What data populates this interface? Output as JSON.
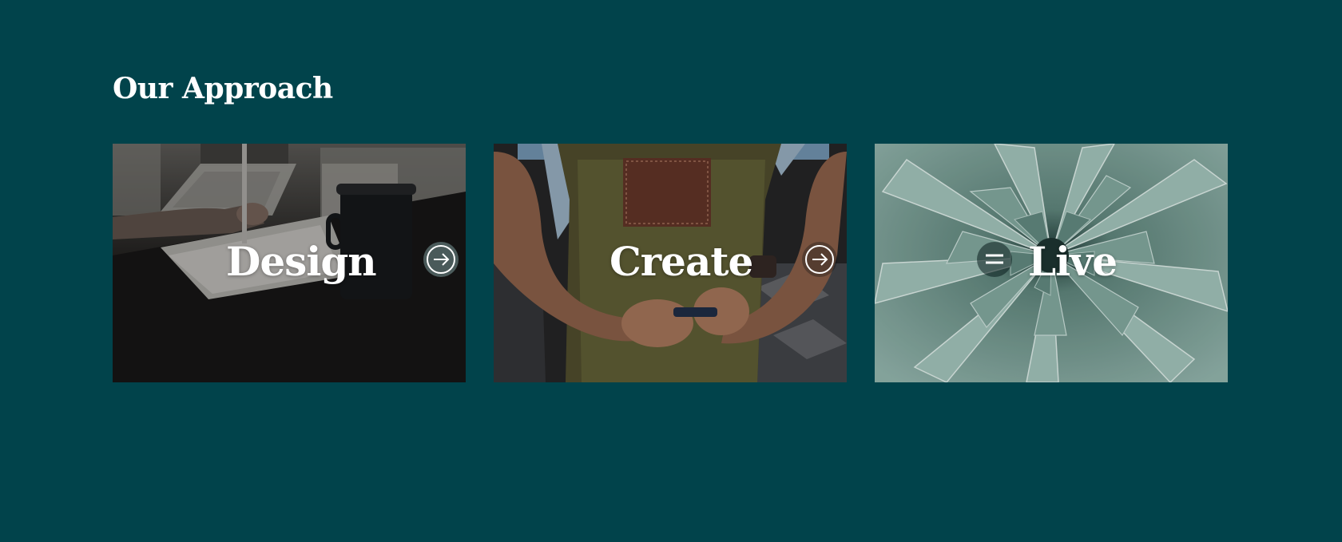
{
  "section": {
    "title": "Our Approach"
  },
  "cards": [
    {
      "label": "Design",
      "icon": "arrow-right-circle-icon",
      "image": "hand-drawing-on-tablet-photo"
    },
    {
      "label": "Create",
      "icon": "arrow-right-circle-icon",
      "image": "craftsman-leather-apron-photo"
    },
    {
      "label": "Live",
      "icon": "menu-icon",
      "image": "agave-succulent-photo"
    }
  ],
  "colors": {
    "background": "#01434b",
    "text": "#ffffff",
    "succulent": "#8fb0a8"
  }
}
